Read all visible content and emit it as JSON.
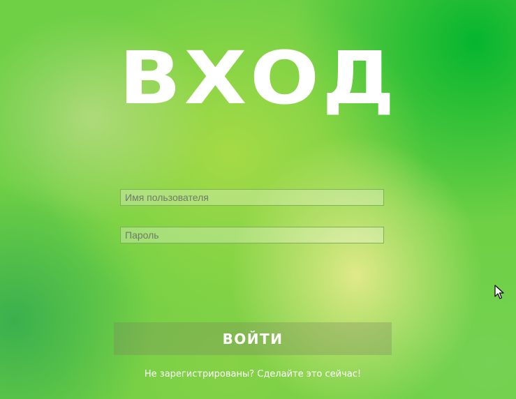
{
  "login": {
    "title": "ВХОД",
    "username": {
      "placeholder": "Имя пользователя",
      "value": ""
    },
    "password": {
      "placeholder": "Пароль",
      "value": ""
    },
    "submit_label": "ВОЙТИ",
    "register_link": "Не зарегистрированы? Сделайте это сейчас!"
  },
  "cursor": {
    "icon": "arrow-cursor-icon"
  },
  "colors": {
    "background_primary": "#6fd045",
    "background_dark": "#00b42d",
    "text": "#ffffff"
  }
}
